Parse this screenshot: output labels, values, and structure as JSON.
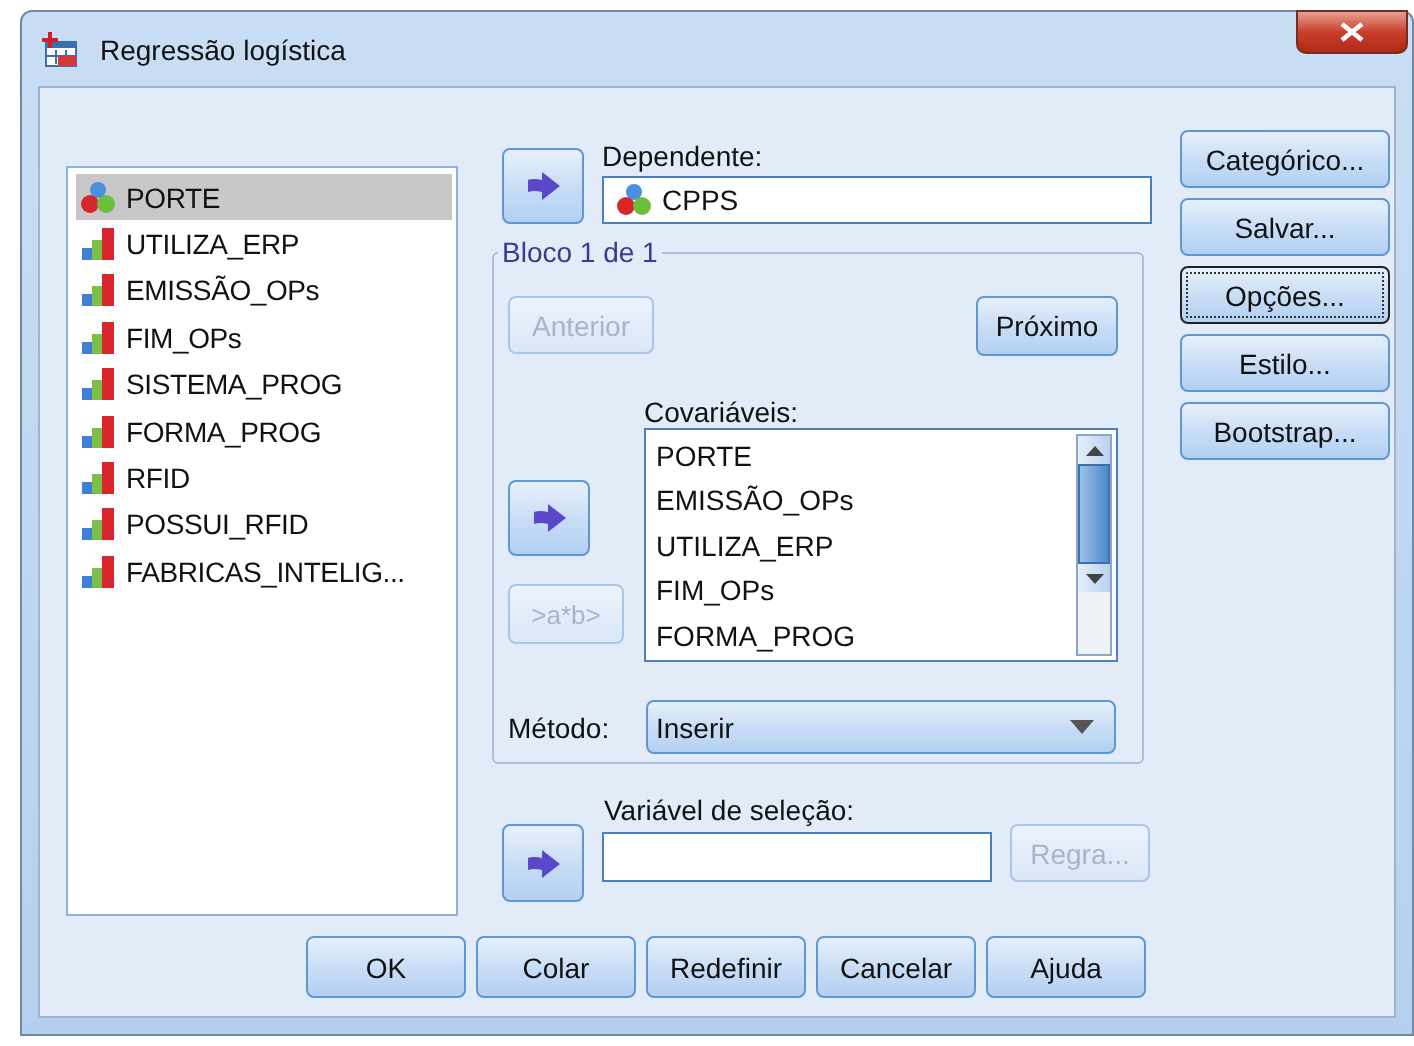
{
  "window": {
    "title": "Regressão logística"
  },
  "variables": [
    {
      "name": "PORTE",
      "kind": "nominal",
      "selected": true
    },
    {
      "name": "UTILIZA_ERP",
      "kind": "scale",
      "selected": false
    },
    {
      "name": "EMISSÃO_OPs",
      "kind": "scale",
      "selected": false
    },
    {
      "name": "FIM_OPs",
      "kind": "scale",
      "selected": false
    },
    {
      "name": "SISTEMA_PROG",
      "kind": "scale",
      "selected": false
    },
    {
      "name": "FORMA_PROG",
      "kind": "scale",
      "selected": false
    },
    {
      "name": "RFID",
      "kind": "scale",
      "selected": false
    },
    {
      "name": "POSSUI_RFID",
      "kind": "scale",
      "selected": false
    },
    {
      "name": "FABRICAS_INTELIG...",
      "kind": "scale",
      "selected": false
    }
  ],
  "dependent": {
    "label": "Dependente:",
    "value": "CPPS",
    "kind": "nominal"
  },
  "block": {
    "title": "Bloco 1 de 1",
    "previous": {
      "label": "Anterior",
      "disabled": true
    },
    "next": {
      "label": "Próximo",
      "disabled": false
    }
  },
  "covariates": {
    "label": "Covariáveis:",
    "items": [
      "PORTE",
      "EMISSÃO_OPs",
      "UTILIZA_ERP",
      "FIM_OPs",
      "FORMA_PROG"
    ]
  },
  "interaction_button": {
    "label": ">a*b>",
    "disabled": true
  },
  "method": {
    "label": "Método:",
    "value": "Inserir"
  },
  "selection": {
    "label": "Variável de seleção:",
    "rule_button": {
      "label": "Regra...",
      "disabled": true
    }
  },
  "side_buttons": [
    {
      "label": "Categórico...",
      "focused": false
    },
    {
      "label": "Salvar...",
      "focused": false
    },
    {
      "label": "Opções...",
      "focused": true
    },
    {
      "label": "Estilo...",
      "focused": false
    },
    {
      "label": "Bootstrap...",
      "focused": false
    }
  ],
  "buttons": [
    {
      "label": "OK"
    },
    {
      "label": "Colar"
    },
    {
      "label": "Redefinir"
    },
    {
      "label": "Cancelar"
    },
    {
      "label": "Ajuda"
    }
  ]
}
